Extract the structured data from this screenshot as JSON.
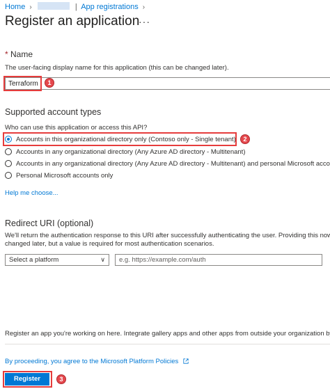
{
  "breadcrumb": {
    "home": "Home",
    "current": "App registrations"
  },
  "page": {
    "title": "Register an application",
    "more": "···"
  },
  "name_section": {
    "star": "*",
    "label": "Name",
    "description": "The user-facing display name for this application (this can be changed later).",
    "value": "Terraform",
    "badge": "1"
  },
  "account_types": {
    "heading": "Supported account types",
    "question": "Who can use this application or access this API?",
    "options": [
      {
        "label": "Accounts in this organizational directory only (Contoso only - Single tenant)",
        "selected": true
      },
      {
        "label": "Accounts in any organizational directory (Any Azure AD directory - Multitenant)",
        "selected": false
      },
      {
        "label": "Accounts in any organizational directory (Any Azure AD directory - Multitenant) and personal Microsoft accou",
        "selected": false
      },
      {
        "label": "Personal Microsoft accounts only",
        "selected": false
      }
    ],
    "badge": "2",
    "help_link": "Help me choose..."
  },
  "redirect": {
    "heading": "Redirect URI (optional)",
    "description_line1": "We'll return the authentication response to this URI after successfully authenticating the user. Providing this now is c",
    "description_line2": "changed later, but a value is required for most authentication scenarios.",
    "platform_placeholder": "Select a platform",
    "url_placeholder": "e.g. https://example.com/auth"
  },
  "footer": {
    "note": "Register an app you're working on here. Integrate gallery apps and other apps from outside your organization by a",
    "policy_text": "By proceeding, you agree to the Microsoft Platform Policies",
    "register_label": "Register",
    "badge": "3"
  },
  "colors": {
    "accent": "#0078d4",
    "annotation": "#e63c3c",
    "text": "#323130"
  }
}
